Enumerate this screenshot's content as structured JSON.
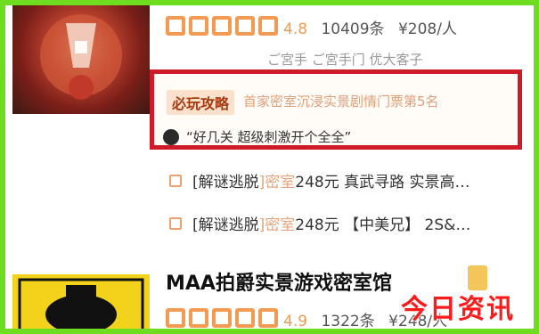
{
  "listing1": {
    "score": "4.8",
    "reviews": "10409条",
    "price": "¥208/人",
    "faded_text": "ご宮手 ご宮手门   优大客子",
    "recommend_tag": "必玩攻略",
    "recommend_text": "首家密室沉浸实景剧情门票第5名",
    "quote": "“好几关 超级刺激开个全全”",
    "deals": [
      {
        "label": "[解谜逃脱",
        "highlight": "]密室",
        "rest": "248元 真武寻路 实景高…"
      },
      {
        "label": "[解谜逃脱",
        "highlight": "]密室",
        "rest": "248元 【中美兄】 2S&…"
      }
    ]
  },
  "listing2": {
    "title": "MAA拍爵实景游戏密室馆",
    "score": "4.9",
    "reviews": "1322条",
    "price": "¥248/人"
  },
  "watermark": "今日资讯",
  "colors": {
    "border": "#6edc1f",
    "highlight_border": "#cf1a2a",
    "star": "#f39b52",
    "watermark": "#ff1a1a"
  }
}
